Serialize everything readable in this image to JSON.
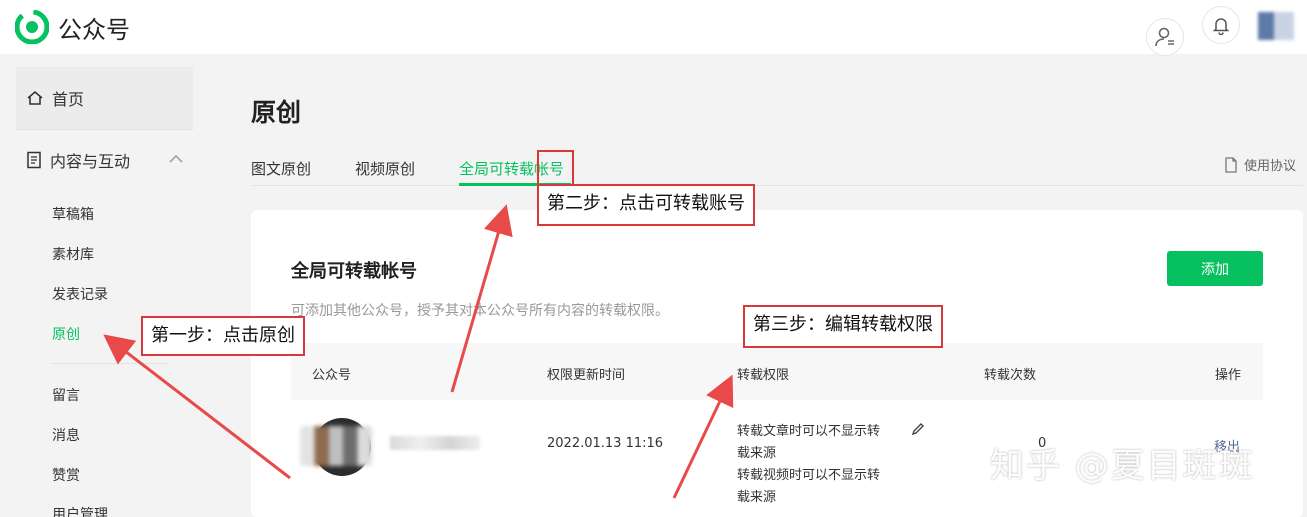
{
  "header": {
    "brand": "公众号"
  },
  "sidebar": {
    "home": "首页",
    "group": "内容与互动",
    "items": [
      "草稿箱",
      "素材库",
      "发表记录",
      "原创",
      "留言",
      "消息",
      "赞赏",
      "用户管理"
    ]
  },
  "main": {
    "title": "原创",
    "tabs": [
      "图文原创",
      "视频原创",
      "全局可转载帐号"
    ],
    "agreement": "使用协议",
    "card_title": "全局可转载帐号",
    "card_desc": "可添加其他公众号，授予其对本公众号所有内容的转载权限。",
    "add_label": "添加",
    "table": {
      "headers": [
        "公众号",
        "权限更新时间",
        "转载权限",
        "转载次数",
        "操作"
      ],
      "row": {
        "time": "2022.01.13 11:16",
        "perm_lines": [
          "转载文章时可以不显示转",
          "载来源",
          "转载视频时可以不显示转",
          "载来源"
        ],
        "count": "0",
        "action": "移出"
      }
    }
  },
  "annotations": {
    "step1": "第一步：点击原创",
    "step2": "第二步：点击可转载账号",
    "step3": "第三步：编辑转载权限"
  },
  "watermark": "知乎 @夏目斑斑",
  "colors": {
    "accent": "#07c160",
    "annotation": "#d9383b"
  }
}
